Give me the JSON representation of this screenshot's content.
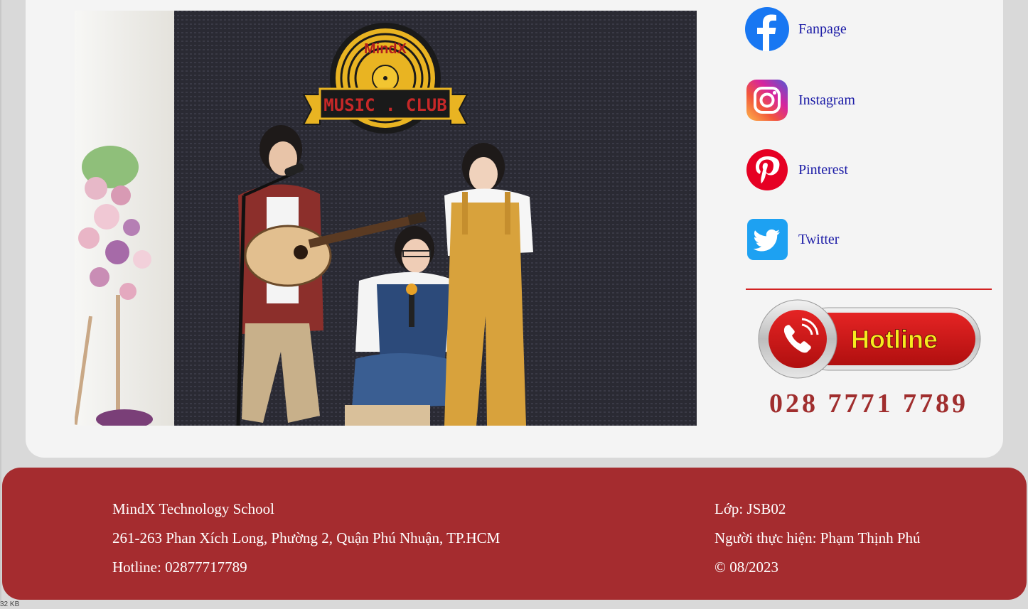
{
  "photo": {
    "logo_top": "MindX",
    "logo_banner": "MUSIC . CLUB"
  },
  "social": {
    "items": [
      {
        "label": "Fanpage",
        "icon": "facebook-icon",
        "color": "#1877f2"
      },
      {
        "label": "Instagram",
        "icon": "instagram-icon",
        "color": "#d6249f"
      },
      {
        "label": "Pinterest",
        "icon": "pinterest-icon",
        "color": "#e60023"
      },
      {
        "label": "Twitter",
        "icon": "twitter-icon",
        "color": "#1da1f2"
      }
    ]
  },
  "hotline": {
    "badge_text": "Hotline",
    "number": "028 7771 7789"
  },
  "footer": {
    "left": [
      "MindX Technology School",
      "261-263 Phan Xích Long, Phường 2, Quận Phú Nhuận, TP.HCM",
      "Hotline: 02877717789"
    ],
    "right": [
      "Lớp: JSB02",
      "Người thực hiện: Phạm Thịnh Phú",
      "© 08/2023"
    ]
  },
  "status": {
    "size_text": "32 KB"
  },
  "colors": {
    "footer_bg": "#a52c2f",
    "hotline_number": "#a02e2e",
    "divider": "#d22222",
    "link": "#1a1aa6"
  }
}
